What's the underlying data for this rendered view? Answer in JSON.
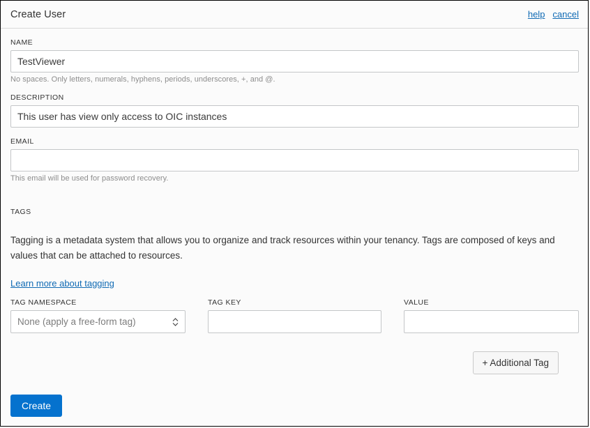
{
  "header": {
    "title": "Create User",
    "help_label": "help",
    "cancel_label": "cancel"
  },
  "form": {
    "name": {
      "label": "NAME",
      "value": "TestViewer",
      "placeholder": "",
      "helper": "No spaces. Only letters, numerals, hyphens, periods, underscores, +, and @."
    },
    "description": {
      "label": "DESCRIPTION",
      "value": "This user has view only access to OIC instances",
      "placeholder": ""
    },
    "email": {
      "label": "EMAIL",
      "value": "",
      "placeholder": "",
      "helper": "This email will be used for password recovery."
    }
  },
  "tags": {
    "label": "TAGS",
    "description": "Tagging is a metadata system that allows you to organize and track resources within your tenancy. Tags are composed of keys and values that can be attached to resources.",
    "learn_link": "Learn more about tagging",
    "namespace": {
      "label": "TAG NAMESPACE",
      "selected": "None (apply a free-form tag)",
      "options": [
        "None (apply a free-form tag)"
      ]
    },
    "key": {
      "label": "TAG KEY",
      "value": "",
      "placeholder": ""
    },
    "value": {
      "label": "VALUE",
      "value": "",
      "placeholder": ""
    },
    "add_button": "+ Additional Tag"
  },
  "actions": {
    "create_label": "Create"
  },
  "colors": {
    "accent": "#0572ce",
    "link": "#0f6ab4",
    "border": "#c4c6c8",
    "background": "#fbfbfb",
    "helper_text": "#8d8d8d"
  }
}
